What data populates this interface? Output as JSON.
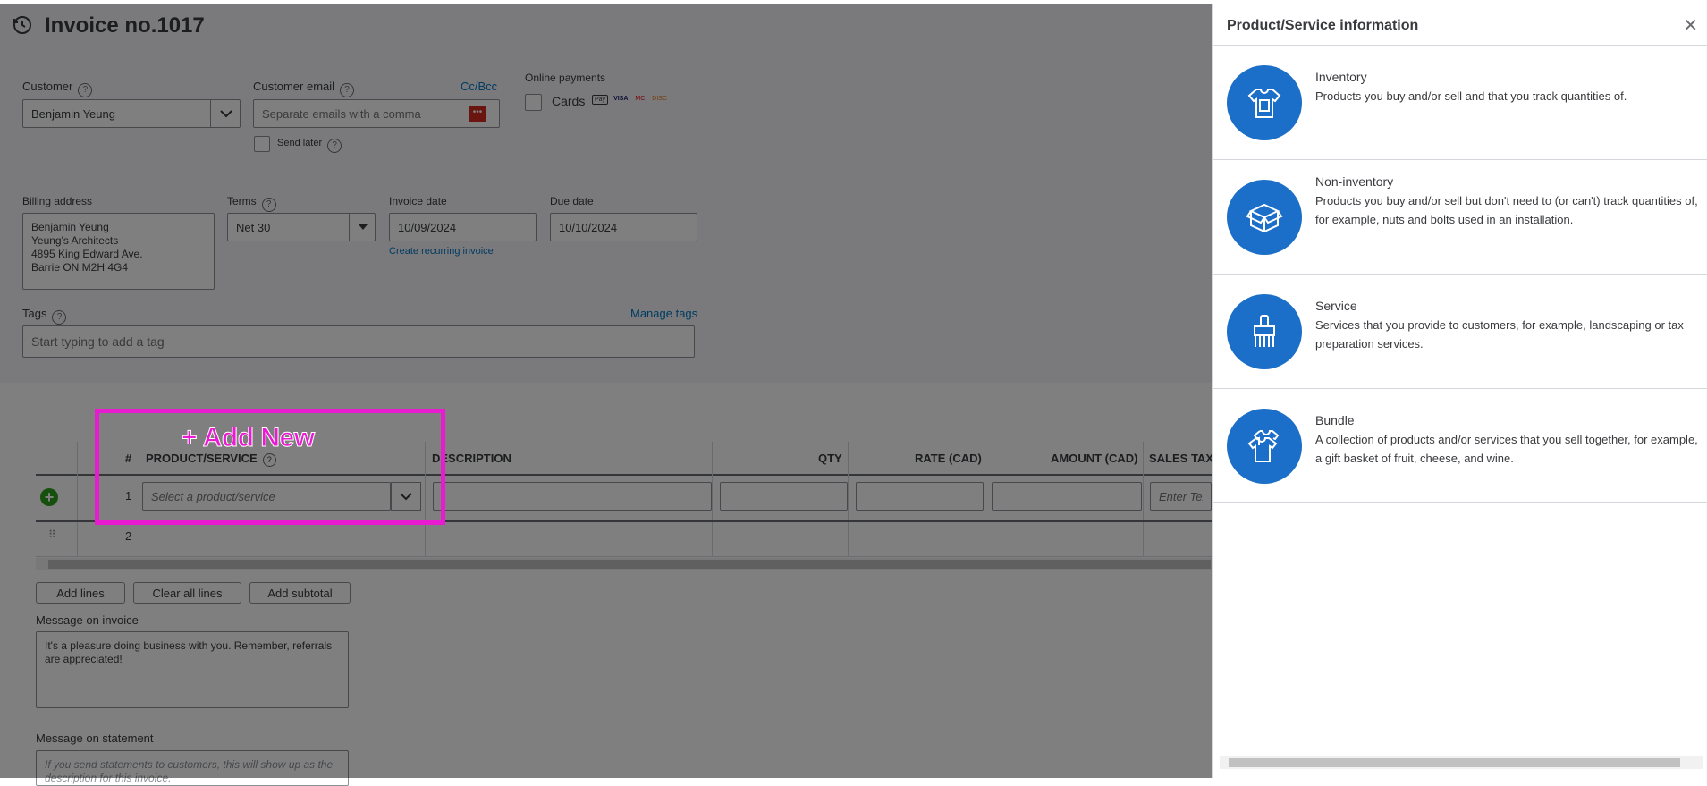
{
  "header": {
    "title": "Invoice no.1017"
  },
  "customer": {
    "label": "Customer",
    "value": "Benjamin Yeung"
  },
  "email": {
    "label": "Customer email",
    "placeholder": "Separate emails with a comma",
    "cc_bcc": "Cc/Bcc",
    "send_later": "Send later"
  },
  "online_payments": {
    "label": "Online payments",
    "cards_label": "Cards",
    "card_brands": [
      "Pay",
      "VISA",
      "MC",
      "DISC"
    ]
  },
  "billing": {
    "label": "Billing address",
    "lines": [
      "Benjamin Yeung",
      "Yeung's Architects",
      "4895 King Edward Ave.",
      "Barrie ON  M2H 4G4"
    ]
  },
  "terms": {
    "label": "Terms",
    "value": "Net 30"
  },
  "invoice_date": {
    "label": "Invoice date",
    "value": "10/09/2024",
    "recurring_link": "Create recurring invoice"
  },
  "due_date": {
    "label": "Due date",
    "value": "10/10/2024"
  },
  "tags": {
    "label": "Tags",
    "manage": "Manage tags",
    "placeholder": "Start typing to add a tag"
  },
  "table": {
    "headers": {
      "num": "#",
      "product": "PRODUCT/SERVICE",
      "description": "DESCRIPTION",
      "qty": "QTY",
      "rate": "RATE (CAD)",
      "amount": "AMOUNT (CAD)",
      "tax": "SALES TAX"
    },
    "rows": [
      {
        "num": "1",
        "product_placeholder": "Select a product/service",
        "tax_placeholder": "Enter Text"
      },
      {
        "num": "2"
      }
    ]
  },
  "buttons": {
    "add_lines": "Add lines",
    "clear_lines": "Clear all lines",
    "add_subtotal": "Add subtotal"
  },
  "message_invoice": {
    "label": "Message on invoice",
    "value": "It's a pleasure doing business with you.  Remember, referrals are appreciated!"
  },
  "message_statement": {
    "label": "Message on statement",
    "placeholder": "If you send statements to customers, this will show up as the description for this invoice."
  },
  "annotation": {
    "text": "+ Add New"
  },
  "panel": {
    "title": "Product/Service information",
    "options": [
      {
        "title": "Inventory",
        "desc": "Products you buy and/or sell and that you track quantities of.",
        "icon": "tshirt-tag-icon"
      },
      {
        "title": "Non-inventory",
        "desc": "Products you buy and/or sell but don't need to (or can't) track quantities of, for example, nuts and bolts used in an installation.",
        "icon": "open-box-icon"
      },
      {
        "title": "Service",
        "desc": "Services that you provide to customers, for example, landscaping or tax preparation services.",
        "icon": "paintbrush-icon"
      },
      {
        "title": "Bundle",
        "desc": "A collection of products and/or services that you sell together, for example, a gift basket of fruit, cheese, and wine.",
        "icon": "stacked-shirts-icon"
      }
    ]
  },
  "colors": {
    "accent": "#0077c5",
    "option_icon_bg": "#1c6fc9",
    "highlight": "#e81bd1",
    "add_green": "#2ca01c"
  }
}
